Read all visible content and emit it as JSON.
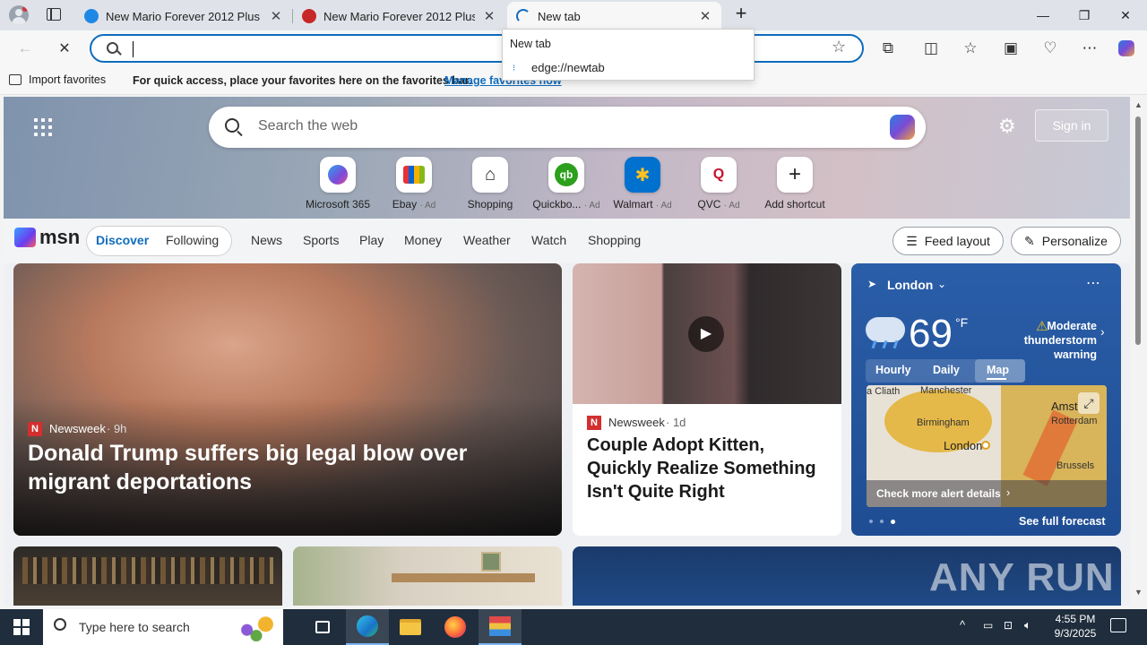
{
  "tabs": [
    {
      "title": "New Mario Forever 2012 Plus"
    },
    {
      "title": "New Mario Forever 2012 Plus"
    },
    {
      "title": "New tab"
    }
  ],
  "window": {
    "minimize": "—",
    "restore": "❐",
    "close": "✕",
    "new_tab": "+"
  },
  "address": {
    "value": "",
    "placeholder": ""
  },
  "dropdown": {
    "header": "New tab",
    "suggestion": "edge://newtab"
  },
  "favorites_bar": {
    "import": "Import favorites",
    "message": "For quick access, place your favorites here on the favorites bar.",
    "manage_link": "Manage favorites now"
  },
  "search": {
    "placeholder": "Search the web"
  },
  "signin": "Sign in",
  "quicklinks": [
    {
      "label": "Microsoft 365",
      "ad": ""
    },
    {
      "label": "Ebay",
      "ad": "· Ad"
    },
    {
      "label": "Shopping",
      "ad": ""
    },
    {
      "label": "Quickbo...",
      "ad": "· Ad"
    },
    {
      "label": "Walmart",
      "ad": "· Ad"
    },
    {
      "label": "QVC",
      "ad": "· Ad"
    },
    {
      "label": "Add shortcut",
      "ad": ""
    }
  ],
  "msn": {
    "logo": "msn",
    "discover": "Discover",
    "following": "Following",
    "feed_layout": "Feed layout",
    "personalize": "Personalize"
  },
  "nav": [
    "News",
    "Sports",
    "Play",
    "Money",
    "Weather",
    "Watch",
    "Shopping"
  ],
  "main_story": {
    "source": "Newsweek",
    "age": "· 9h",
    "headline": "Donald Trump suffers big legal blow over migrant deportations"
  },
  "story2": {
    "source": "Newsweek",
    "age": "· 1d",
    "headline": "Couple Adopt Kitten, Quickly Realize Something Isn't Quite Right"
  },
  "weather": {
    "city": "London",
    "temp": "69",
    "unit": "°F",
    "alert": "Moderate thunderstorm warning",
    "tabs": [
      "Hourly",
      "Daily",
      "Map"
    ],
    "map_labels": [
      "Manchester",
      "Birmingham",
      "London",
      "Amst",
      "Rotterdam",
      "Brussels",
      "a Cliath"
    ],
    "check_more": "Check more alert details",
    "forecast": "See full forecast"
  },
  "watermark": "ANY RUN",
  "taskbar": {
    "search_placeholder": "Type here to search",
    "time": "4:55 PM",
    "date": "9/3/2025"
  },
  "colors": {
    "accent": "#0f6cbd",
    "taskbar": "#1f2d3d",
    "weather_bg": "#27579d"
  }
}
